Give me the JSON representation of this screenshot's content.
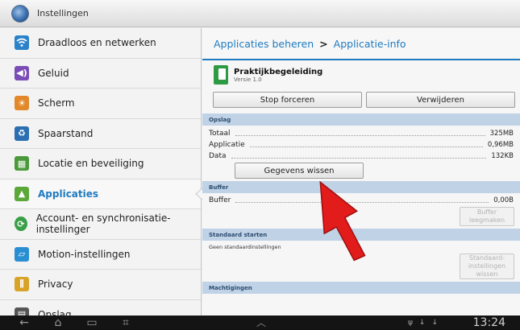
{
  "titlebar": {
    "title": "Instellingen"
  },
  "sidebar": {
    "items": [
      {
        "label": "Draadloos en netwerken",
        "icon": "wifi-icon",
        "color": "#2b82c9"
      },
      {
        "label": "Geluid",
        "icon": "speaker-icon",
        "color": "#7b4bb6"
      },
      {
        "label": "Scherm",
        "icon": "brightness-icon",
        "color": "#e1892a"
      },
      {
        "label": "Spaarstand",
        "icon": "battery-icon",
        "color": "#2b6fb2"
      },
      {
        "label": "Locatie en beveiliging",
        "icon": "grid-lock-icon",
        "color": "#4a9a3b"
      },
      {
        "label": "Applicaties",
        "icon": "android-icon",
        "color": "#5aa83a"
      },
      {
        "label": "Account- en synchronisatie-instellinger",
        "icon": "sync-icon",
        "color": "#3aa048"
      },
      {
        "label": "Motion-instellingen",
        "icon": "motion-icon",
        "color": "#2a8fd2"
      },
      {
        "label": "Privacy",
        "icon": "fence-icon",
        "color": "#d9a228"
      },
      {
        "label": "Opslag",
        "icon": "storage-icon",
        "color": "#555555"
      }
    ],
    "active_index": 5
  },
  "panel": {
    "breadcrumb": {
      "part1": "Applicaties beheren",
      "sep": ">",
      "part2": "Applicatie-info"
    },
    "app": {
      "name": "Praktijkbegeleiding",
      "version": "Versie 1.0"
    },
    "buttons": {
      "force_stop": "Stop forceren",
      "uninstall": "Verwijderen"
    },
    "storage": {
      "header": "Opslag",
      "rows": [
        {
          "key": "Totaal",
          "value": "325MB"
        },
        {
          "key": "Applicatie",
          "value": "0,96MB"
        },
        {
          "key": "Data",
          "value": "132KB"
        }
      ],
      "clear_button": "Gegevens wissen"
    },
    "buffer": {
      "header": "Buffer",
      "key": "Buffer",
      "value": "0,00B",
      "clear_button_line1": "Buffer",
      "clear_button_line2": "leegmaken"
    },
    "default_start": {
      "header": "Standaard starten",
      "note": "Geen standaardinstellingen",
      "button_line1": "Standaard-",
      "button_line2": "instellingen",
      "button_line3": "wissen"
    },
    "permissions": {
      "header": "Machtigingen"
    }
  },
  "navbar": {
    "clock": "13:24"
  },
  "colors": {
    "accent": "#1f7bc0",
    "section": "#bfd2e6",
    "arrow": "#e21b1b"
  }
}
